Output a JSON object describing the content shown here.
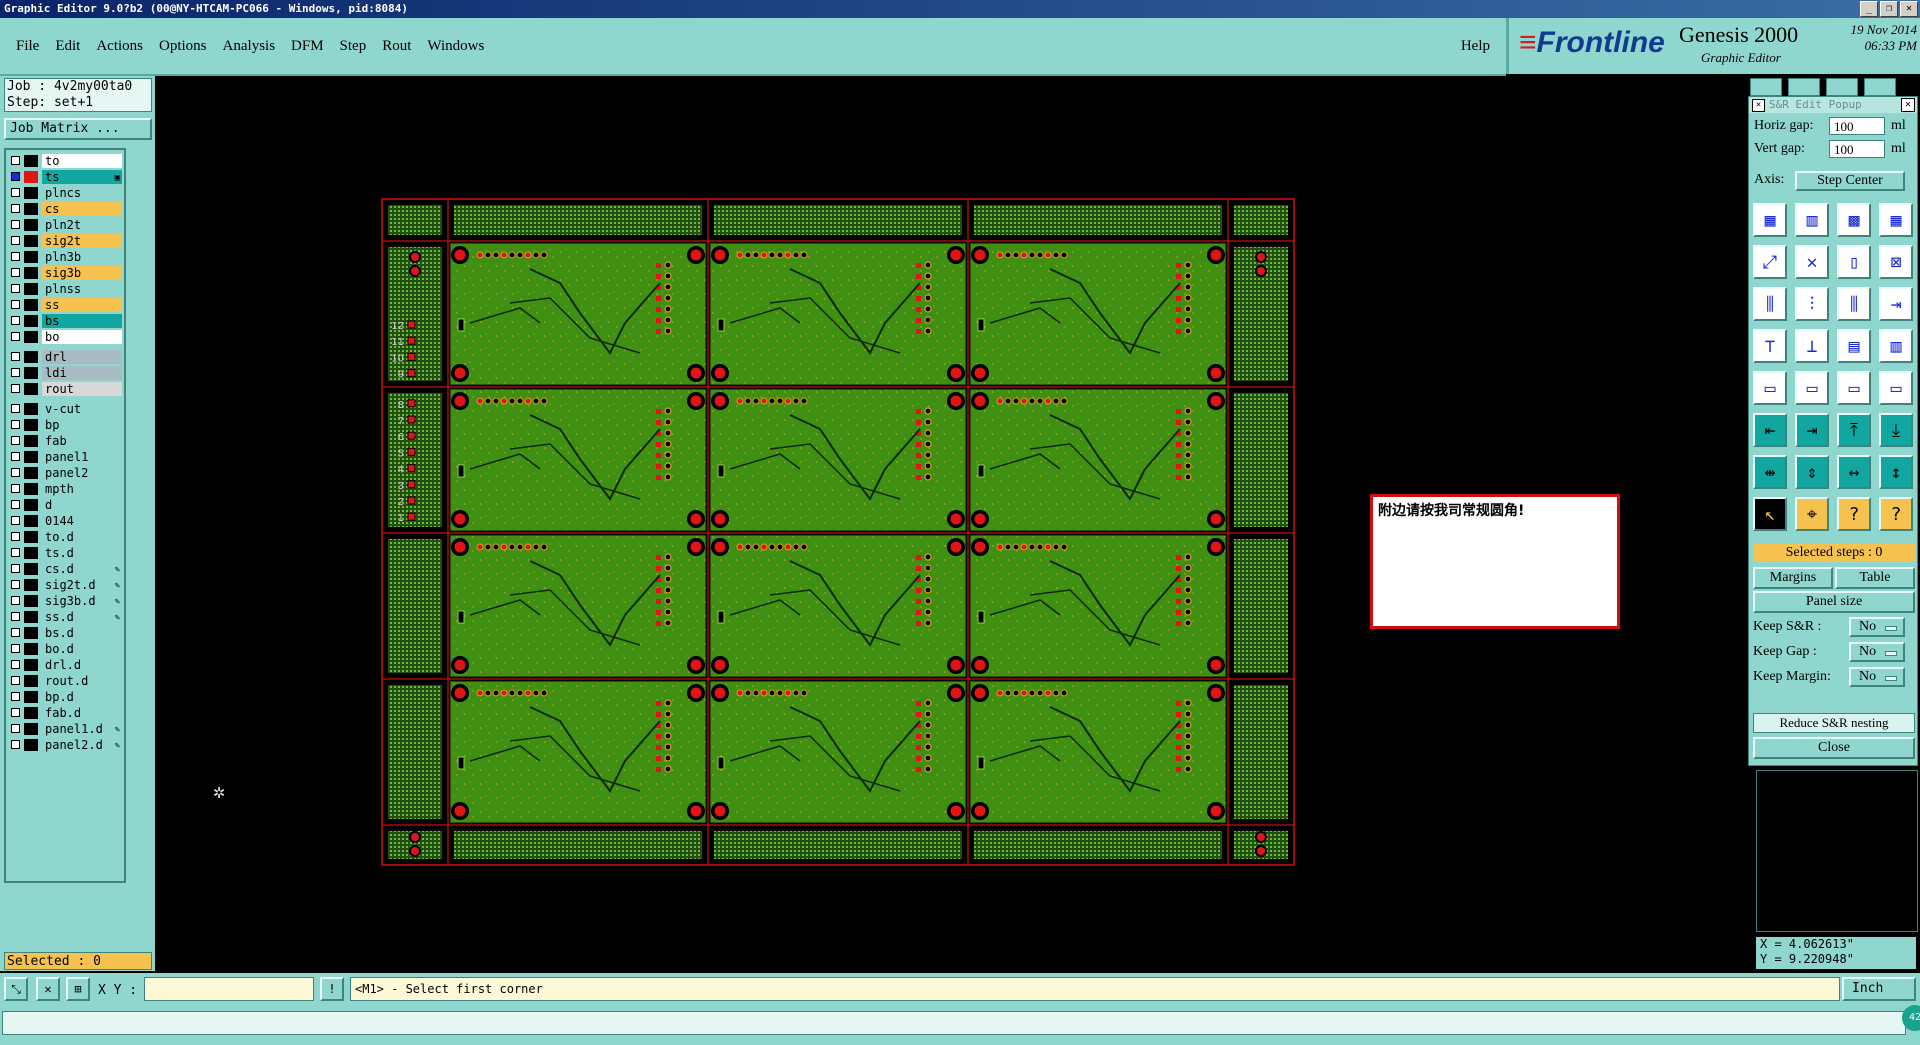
{
  "window": {
    "title": "Graphic Editor 9.0?b2 (00@NY-HTCAM-PC066 - Windows, pid:8084)",
    "controls": [
      "_",
      "❐",
      "✕"
    ]
  },
  "menu": {
    "items": [
      "File",
      "Edit",
      "Actions",
      "Options",
      "Analysis",
      "DFM",
      "Step",
      "Rout",
      "Windows"
    ],
    "help": "Help"
  },
  "brand": {
    "logo": "Frontline",
    "product": "Genesis 2000",
    "subtitle": "Graphic Editor",
    "date": "19 Nov 2014",
    "time": "06:33 PM"
  },
  "job": {
    "job_line": "Job : 4v2my00ta0",
    "step_line": "Step: set+1",
    "matrix_button": "Job Matrix ..."
  },
  "layers": [
    {
      "name": "to",
      "bg": "#ffffff",
      "swatch": "#ffffff",
      "checked": false
    },
    {
      "name": "ts",
      "bg": "#12a6a0",
      "swatch": "#e01515",
      "checked": true,
      "mark": "▣"
    },
    {
      "name": "plncs",
      "bg": "#8fd6cf",
      "swatch": "#ffffff",
      "checked": false
    },
    {
      "name": "cs",
      "bg": "#f5c24f",
      "swatch": "#22a02a",
      "checked": false
    },
    {
      "name": "pln2t",
      "bg": "#8fd6cf",
      "swatch": "#ffffff",
      "checked": false
    },
    {
      "name": "sig2t",
      "bg": "#f5c24f",
      "swatch": "#ffffff",
      "checked": false
    },
    {
      "name": "pln3b",
      "bg": "#8fd6cf",
      "swatch": "#ffffff",
      "checked": false
    },
    {
      "name": "sig3b",
      "bg": "#f5c24f",
      "swatch": "#ffffff",
      "checked": false
    },
    {
      "name": "plnss",
      "bg": "#8fd6cf",
      "swatch": "#ffffff",
      "checked": false
    },
    {
      "name": "ss",
      "bg": "#f5c24f",
      "swatch": "#ffffff",
      "checked": false
    },
    {
      "name": "bs",
      "bg": "#12a6a0",
      "swatch": "#ffffff",
      "checked": false
    },
    {
      "name": "bo",
      "bg": "#ffffff",
      "swatch": "#ffffff",
      "checked": false
    },
    {
      "name": "drl",
      "bg": "#a8bcc4",
      "swatch": "#ffffff",
      "checked": false
    },
    {
      "name": "ldi",
      "bg": "#a8bcc4",
      "swatch": "#ffffff",
      "checked": false
    },
    {
      "name": "rout",
      "bg": "#d8d8d8",
      "swatch": "#ffffff",
      "checked": false
    },
    {
      "name": "v-cut",
      "bg": "#8fd6cf",
      "swatch": "#ffffff",
      "checked": false
    },
    {
      "name": "bp",
      "bg": "#8fd6cf",
      "swatch": "#ffffff",
      "checked": false
    },
    {
      "name": "fab",
      "bg": "#8fd6cf",
      "swatch": "#ffffff",
      "checked": false
    },
    {
      "name": "panel1",
      "bg": "#8fd6cf",
      "swatch": "#ffffff",
      "checked": false
    },
    {
      "name": "panel2",
      "bg": "#8fd6cf",
      "swatch": "#ffffff",
      "checked": false
    },
    {
      "name": "mpth",
      "bg": "#8fd6cf",
      "swatch": "#ffffff",
      "checked": false
    },
    {
      "name": "d",
      "bg": "#8fd6cf",
      "swatch": "#ffffff",
      "checked": false
    },
    {
      "name": "0144",
      "bg": "#8fd6cf",
      "swatch": "#ffffff",
      "checked": false
    },
    {
      "name": "to.d",
      "bg": "#8fd6cf",
      "swatch": "#ffffff",
      "checked": false
    },
    {
      "name": "ts.d",
      "bg": "#8fd6cf",
      "swatch": "#ffffff",
      "checked": false
    },
    {
      "name": "cs.d",
      "bg": "#8fd6cf",
      "swatch": "#ffffff",
      "checked": false,
      "mark": "✎"
    },
    {
      "name": "sig2t.d",
      "bg": "#8fd6cf",
      "swatch": "#ffffff",
      "checked": false,
      "mark": "✎"
    },
    {
      "name": "sig3b.d",
      "bg": "#8fd6cf",
      "swatch": "#ffffff",
      "checked": false,
      "mark": "✎"
    },
    {
      "name": "ss.d",
      "bg": "#8fd6cf",
      "swatch": "#ffffff",
      "checked": false,
      "mark": "✎"
    },
    {
      "name": "bs.d",
      "bg": "#8fd6cf",
      "swatch": "#ffffff",
      "checked": false
    },
    {
      "name": "bo.d",
      "bg": "#8fd6cf",
      "swatch": "#ffffff",
      "checked": false
    },
    {
      "name": "drl.d",
      "bg": "#8fd6cf",
      "swatch": "#ffffff",
      "checked": false
    },
    {
      "name": "rout.d",
      "bg": "#8fd6cf",
      "swatch": "#ffffff",
      "checked": false
    },
    {
      "name": "bp.d",
      "bg": "#8fd6cf",
      "swatch": "#ffffff",
      "checked": false
    },
    {
      "name": "fab.d",
      "bg": "#8fd6cf",
      "swatch": "#ffffff",
      "checked": false
    },
    {
      "name": "panel1.d",
      "bg": "#8fd6cf",
      "swatch": "#ffffff",
      "checked": false,
      "mark": "✎"
    },
    {
      "name": "panel2.d",
      "bg": "#8fd6cf",
      "swatch": "#ffffff",
      "checked": false,
      "mark": "✎"
    }
  ],
  "selected_count": "Selected : 0",
  "canvas": {
    "rows": 4,
    "cols": 3,
    "side_numbers": [
      "12",
      "11",
      "10",
      "9",
      "8",
      "7",
      "6",
      "5",
      "4",
      "3",
      "2",
      "1"
    ],
    "note": "附边请按我司常规圆角!"
  },
  "sr_popup": {
    "title": "S&R Edit Popup",
    "horiz_gap_label": "Horiz gap:",
    "horiz_gap_value": "100",
    "horiz_gap_unit": "ml",
    "vert_gap_label": "Vert  gap:",
    "vert_gap_value": "100",
    "vert_gap_unit": "ml",
    "axis_label": "Axis:",
    "axis_value": "Step Center",
    "icon_names": [
      "grid-2x2-icon",
      "grid-red-icon",
      "grid-mixed-icon",
      "grid-3x3-icon",
      "rotate-step-icon",
      "delete-step-icon",
      "mirror-step-icon",
      "remove-step-icon",
      "split-h-icon",
      "split-v-icon",
      "split-mixed-icon",
      "move-step-icon",
      "tree-icon",
      "tree-alt-icon",
      "row-3-icon",
      "column-3-icon",
      "stack-v-icon",
      "stack-h-icon",
      "stack-row-icon",
      "stack-col-icon",
      "arrow-left-icon",
      "arrow-right-icon",
      "arrow-up-icon",
      "arrow-down-icon",
      "spread-h-icon",
      "spread-v-icon",
      "compress-h-icon",
      "compress-v-icon",
      "pointer-icon",
      "select-step-icon",
      "query-icon",
      "help-step-icon"
    ],
    "selected_steps": "Selected steps : 0",
    "margins_label": "Margins",
    "table_label": "Table",
    "panel_size_label": "Panel size",
    "keep_sr_label": "Keep S&R    :",
    "keep_sr_value": "No",
    "keep_gap_label": "Keep Gap     :",
    "keep_gap_value": "No",
    "keep_margin_label": "Keep Margin:",
    "keep_margin_value": "No",
    "reduce_label": "Reduce S&R nesting",
    "close_label": "Close"
  },
  "coords": {
    "x": "X = 4.062613\"",
    "y": "Y = 9.220948\""
  },
  "statusbar": {
    "xy_label": "X Y :",
    "xy_value": "",
    "prompt": "<M1> - Select first corner",
    "unit": "Inch",
    "badge": "42"
  },
  "colors": {
    "ui": "#8fd6cf",
    "accent": "#f5c24f",
    "board": "#3f8f12",
    "outline": "#d01010"
  }
}
